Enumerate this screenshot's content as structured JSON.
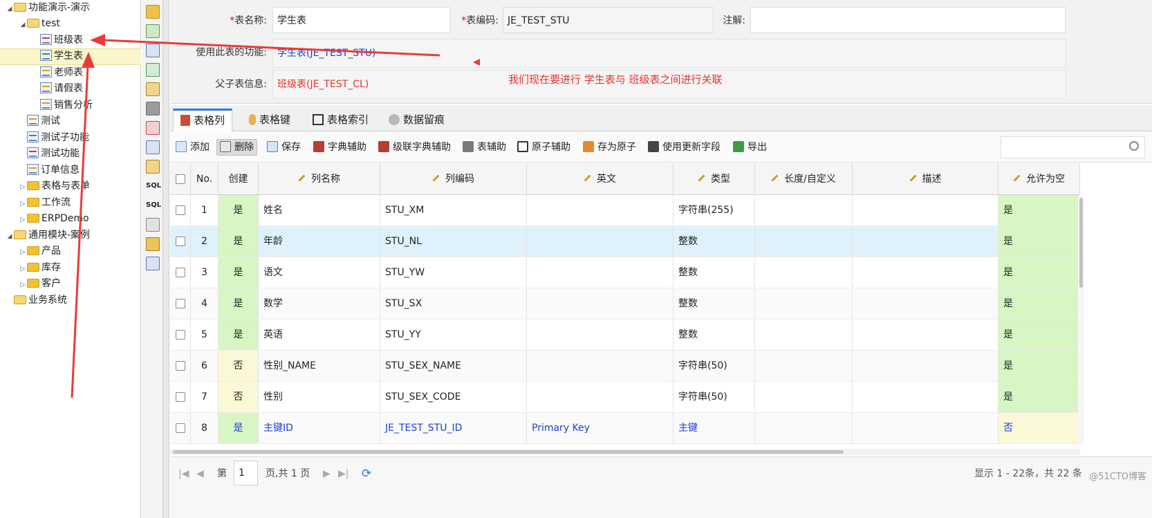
{
  "tree": {
    "nodes": [
      {
        "label": "功能演示-演示",
        "type": "folder-open",
        "expander": "◢"
      },
      {
        "label": "test",
        "type": "folder-open",
        "expander": "◢"
      },
      {
        "label": "班级表",
        "type": "table-red"
      },
      {
        "label": "学生表",
        "type": "table-green"
      },
      {
        "label": "老师表",
        "type": "table-yellow"
      },
      {
        "label": "请假表",
        "type": "table-yellow"
      },
      {
        "label": "销售分析",
        "type": "table-yellow"
      },
      {
        "label": "测试",
        "type": "table-yellow"
      },
      {
        "label": "测试子功能",
        "type": "table-green"
      },
      {
        "label": "测试功能",
        "type": "table-red"
      },
      {
        "label": "订单信息",
        "type": "table-yellow"
      },
      {
        "label": "表格与表单",
        "type": "folder",
        "expander": "▷"
      },
      {
        "label": "工作流",
        "type": "folder",
        "expander": "▷"
      },
      {
        "label": "ERPDemo",
        "type": "folder",
        "expander": "▷"
      },
      {
        "label": "通用模块-案例",
        "type": "folder-open",
        "expander": "◢"
      },
      {
        "label": "产品",
        "type": "folder",
        "expander": "▷"
      },
      {
        "label": "库存",
        "type": "folder",
        "expander": "▷"
      },
      {
        "label": "客户",
        "type": "folder",
        "expander": "▷"
      },
      {
        "label": "业务系统",
        "type": "folder-open"
      }
    ]
  },
  "form": {
    "table_name_label": "表名称:",
    "table_name_value": "学生表",
    "table_code_label": "表编码:",
    "table_code_value": "JE_TEST_STU",
    "note_label": "注解:",
    "note_value": "",
    "used_by_label": "使用此表的功能:",
    "used_by_value": "学生表(JE_TEST_STU)",
    "parent_child_label": "父子表信息:",
    "parent_child_value": "班级表(JE_TEST_CL)",
    "required_mark": "*"
  },
  "annotation": "我们现在要进行  学生表与  班级表之间进行关联",
  "tabs": [
    {
      "label": "表格列",
      "icon": "columns-icon"
    },
    {
      "label": "表格键",
      "icon": "key-icon"
    },
    {
      "label": "表格索引",
      "icon": "index-icon"
    },
    {
      "label": "数据留痕",
      "icon": "trace-icon"
    }
  ],
  "toolbar": {
    "buttons": [
      {
        "label": "添加",
        "icon": "add-icon"
      },
      {
        "label": "删除",
        "icon": "delete-icon"
      },
      {
        "label": "保存",
        "icon": "save-icon"
      },
      {
        "label": "字典辅助",
        "icon": "dict-icon"
      },
      {
        "label": "级联字典辅助",
        "icon": "cascade-dict-icon"
      },
      {
        "label": "表辅助",
        "icon": "table-helper-icon"
      },
      {
        "label": "原子辅助",
        "icon": "atom-icon"
      },
      {
        "label": "存为原子",
        "icon": "save-atom-icon"
      },
      {
        "label": "使用更新字段",
        "icon": "update-fields-icon"
      },
      {
        "label": "导出",
        "icon": "excel-icon"
      }
    ],
    "search_placeholder": ""
  },
  "grid": {
    "columns": [
      "",
      "No.",
      "创建",
      "列名称",
      "列编码",
      "英文",
      "类型",
      "长度/自定义",
      "描述",
      "允许为空"
    ],
    "rows": [
      {
        "no": "1",
        "create": "是",
        "name": "姓名",
        "code": "STU_XM",
        "english": "",
        "type": "字符串(255)",
        "length": "",
        "desc": "",
        "nullable": "是"
      },
      {
        "no": "2",
        "create": "是",
        "name": "年龄",
        "code": "STU_NL",
        "english": "",
        "type": "整数",
        "length": "",
        "desc": "",
        "nullable": "是"
      },
      {
        "no": "3",
        "create": "是",
        "name": "语文",
        "code": "STU_YW",
        "english": "",
        "type": "整数",
        "length": "",
        "desc": "",
        "nullable": "是"
      },
      {
        "no": "4",
        "create": "是",
        "name": "数学",
        "code": "STU_SX",
        "english": "",
        "type": "整数",
        "length": "",
        "desc": "",
        "nullable": "是"
      },
      {
        "no": "5",
        "create": "是",
        "name": "英语",
        "code": "STU_YY",
        "english": "",
        "type": "整数",
        "length": "",
        "desc": "",
        "nullable": "是"
      },
      {
        "no": "6",
        "create": "否",
        "name": "性别_NAME",
        "code": "STU_SEX_NAME",
        "english": "",
        "type": "字符串(50)",
        "length": "",
        "desc": "",
        "nullable": "是"
      },
      {
        "no": "7",
        "create": "否",
        "name": "性别",
        "code": "STU_SEX_CODE",
        "english": "",
        "type": "字符串(50)",
        "length": "",
        "desc": "",
        "nullable": "是"
      },
      {
        "no": "8",
        "create": "是",
        "name": "主键ID",
        "code": "JE_TEST_STU_ID",
        "english": "Primary Key",
        "type": "主键",
        "length": "",
        "desc": "",
        "nullable": "否"
      }
    ]
  },
  "pager": {
    "page_prefix": "第",
    "page_value": "1",
    "page_suffix": "页,共 1 页",
    "display_info": "显示 1 - 22条，共 22 条"
  },
  "watermark": "@51CTO博客",
  "colors": {
    "accent": "#2d7bd6",
    "create_yes": "#d8f5c4",
    "create_no": "#fbf8d6",
    "selected_row": "#dff2fb",
    "annotation": "#e8312f",
    "pk_text": "#1a3fd6"
  }
}
